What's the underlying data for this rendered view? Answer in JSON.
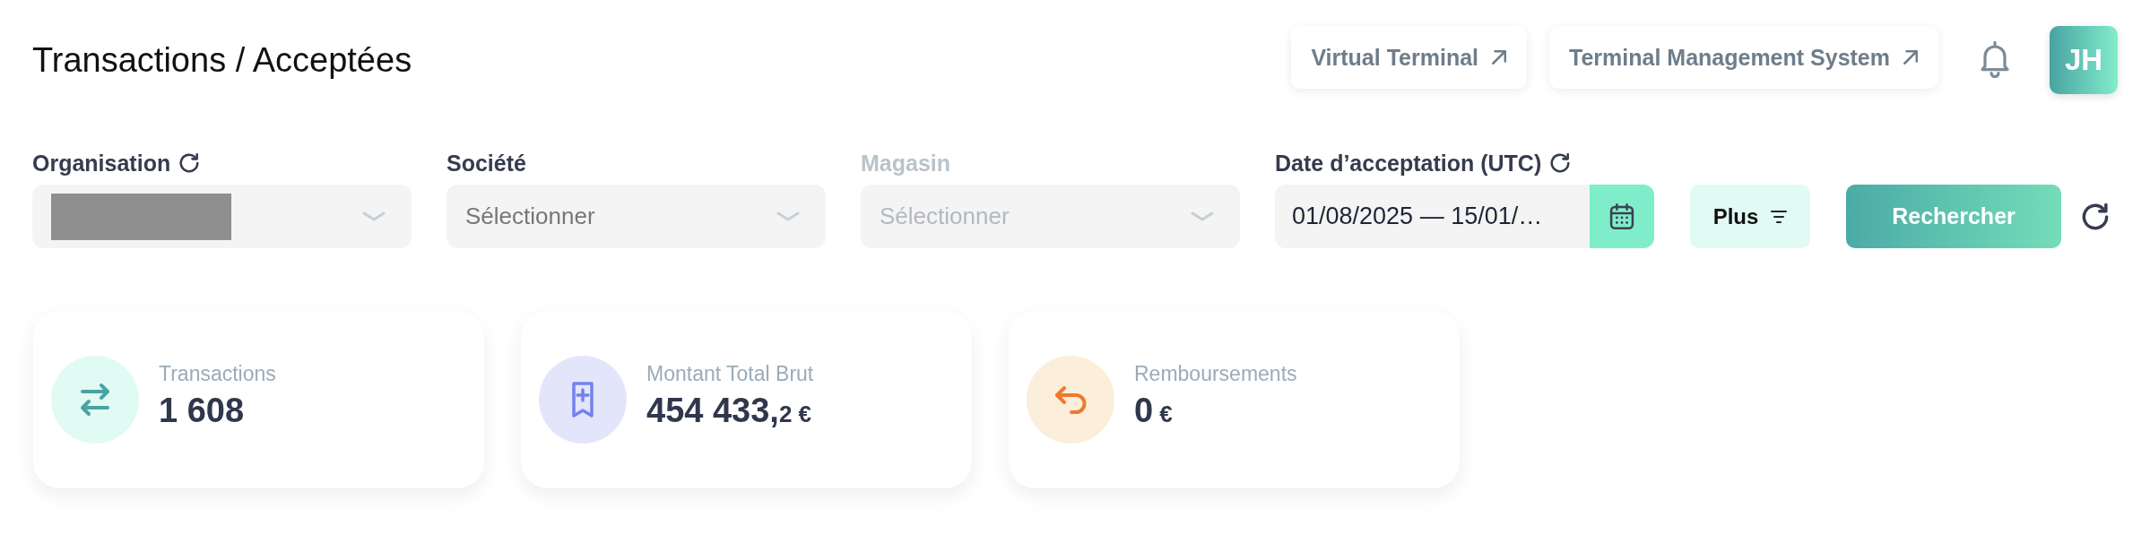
{
  "header": {
    "title": "Transactions / Acceptées",
    "links": [
      {
        "label": "Virtual Terminal"
      },
      {
        "label": "Terminal Management System"
      }
    ],
    "avatar": {
      "initials": "JH"
    }
  },
  "filters": [
    {
      "kind": "select",
      "label": "Organisation",
      "refresh": true,
      "disabled": false,
      "redacted": true
    },
    {
      "kind": "select",
      "label": "Société",
      "placeholder": "Sélectionner",
      "refresh": false,
      "disabled": false,
      "redacted": false
    },
    {
      "kind": "select",
      "label": "Magasin",
      "placeholder": "Sélectionner",
      "refresh": false,
      "disabled": true,
      "redacted": false
    },
    {
      "kind": "date",
      "label": "Date d’acceptation (UTC)",
      "value": "01/08/2025 — 15/01/…",
      "refresh": true,
      "disabled": false,
      "redacted": false
    }
  ],
  "actions": {
    "more": {
      "label": "Plus"
    },
    "search": {
      "label": "Rechercher"
    }
  },
  "stats": [
    {
      "kind": "transfers",
      "label": "Transactions",
      "value": "1 608"
    },
    {
      "kind": "amount",
      "label": "Montant Total Brut",
      "value": "454 433,",
      "decimals": "2",
      "currency": "€"
    },
    {
      "kind": "refunds",
      "label": "Remboursements",
      "value": "0",
      "currency": "€"
    }
  ]
}
